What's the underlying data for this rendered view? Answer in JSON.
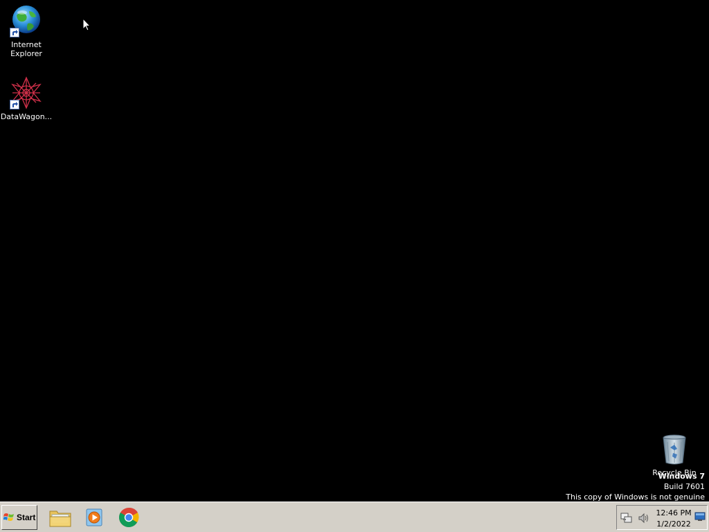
{
  "desktop": {
    "background_color": "#000000",
    "icons": [
      {
        "name": "internet-explorer",
        "label": "Internet Explorer",
        "icon": "ie-globe-icon",
        "shortcut": true
      },
      {
        "name": "datawagon",
        "label": "DataWagon...",
        "icon": "datawagon-icon",
        "shortcut": true
      },
      {
        "name": "recycle-bin",
        "label": "Recycle Bin",
        "icon": "recycle-bin-icon",
        "shortcut": false
      }
    ]
  },
  "watermark": {
    "title": "Windows 7",
    "build": "Build 7601",
    "notice": "This copy of Windows is not genuine"
  },
  "taskbar": {
    "start_label": "Start",
    "pinned": [
      {
        "name": "windows-explorer",
        "icon": "folder-icon"
      },
      {
        "name": "media-player",
        "icon": "media-player-icon"
      },
      {
        "name": "google-chrome",
        "icon": "chrome-icon"
      }
    ],
    "tray": {
      "icons": [
        "network-icon",
        "volume-icon",
        "show-desktop-icon"
      ],
      "time": "12:46 PM",
      "date": "1/2/2022"
    }
  }
}
